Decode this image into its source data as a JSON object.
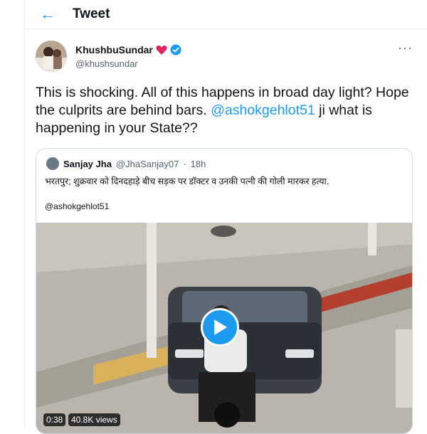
{
  "header": {
    "title": "Tweet",
    "back_icon": "arrow-left-icon"
  },
  "author": {
    "name": "KhushbuSundar",
    "handle": "@khushsundar",
    "heart_color": "#e0245e",
    "verified_color": "#1d9bf0"
  },
  "tweet": {
    "text_before": "This is shocking. All of this happens in broad day light? Hope the culprits are behind bars. ",
    "mention": "@ashokgehlot51",
    "text_after": " ji what is happening in your State??"
  },
  "quote": {
    "name": "Sanjay Jha",
    "handle": "@JhaSanjay07",
    "separator": "·",
    "time": "18h",
    "text": "भरतपुर; शुक्रवार को दिनदहाड़े बीच सड़क पर डॉक्टर व उनकी पत्नी की गोली मारकर हत्या.",
    "mention": "@ashokgehlot51",
    "video": {
      "duration": "0:38",
      "views": "40.8K views"
    }
  },
  "colors": {
    "accent": "#1d9bf0",
    "text": "#0f1419",
    "muted": "#536471",
    "border": "#cfd9de"
  }
}
